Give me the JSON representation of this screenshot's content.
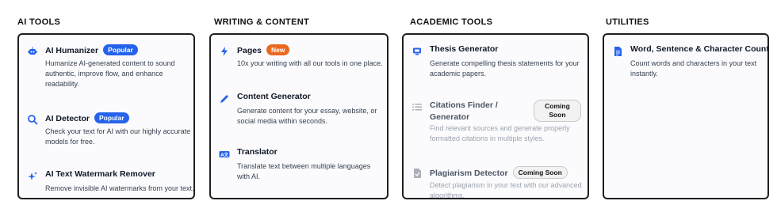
{
  "columns": [
    {
      "title": "AI TOOLS",
      "items": [
        {
          "icon": "robot-icon",
          "title": "AI Humanizer",
          "badge": "Popular",
          "desc": "Humanize AI-generated content to sound authentic, improve flow, and enhance readability."
        },
        {
          "icon": "search-icon",
          "title": "AI Detector",
          "badge": "Popular",
          "desc": "Check your text for AI with our highly accurate models for free."
        },
        {
          "icon": "sparkles-icon",
          "title": "AI Text Watermark Remover",
          "desc": "Remove invisible AI watermarks from your text."
        }
      ]
    },
    {
      "title": "WRITING & CONTENT",
      "items": [
        {
          "icon": "lightning-icon",
          "title": "Pages",
          "badge": "New",
          "desc": "10x your writing with all our tools in one place."
        },
        {
          "icon": "pencil-icon",
          "title": "Content Generator",
          "desc": "Generate content for your essay, website, or social media within seconds."
        },
        {
          "icon": "translate-icon",
          "title": "Translator",
          "desc": "Translate text between multiple languages with AI."
        }
      ]
    },
    {
      "title": "ACADEMIC TOOLS",
      "items": [
        {
          "icon": "monitor-icon",
          "title": "Thesis Generator",
          "desc": "Generate compelling thesis statements for your academic papers."
        },
        {
          "icon": "list-icon",
          "title": "Citations Finder / Generator",
          "title_line1": "Citations Finder /",
          "title_line2": "Generator",
          "badge": "Coming Soon",
          "desc": "Find relevant sources and generate properly formatted citations in multiple styles."
        },
        {
          "icon": "document-check-icon",
          "title": "Plagiarism Detector",
          "badge": "Coming Soon",
          "desc": "Detect plagiarism in your text with our advanced algorithms."
        }
      ]
    },
    {
      "title": "UTILITIES",
      "items": [
        {
          "icon": "document-icon",
          "title": "Word, Sentence & Character Counter",
          "desc": "Count words and characters in your text instantly."
        }
      ]
    }
  ],
  "colors": {
    "accent_blue": "#2563eb",
    "accent_orange": "#ea6a1f",
    "border": "#1f1f1f"
  }
}
